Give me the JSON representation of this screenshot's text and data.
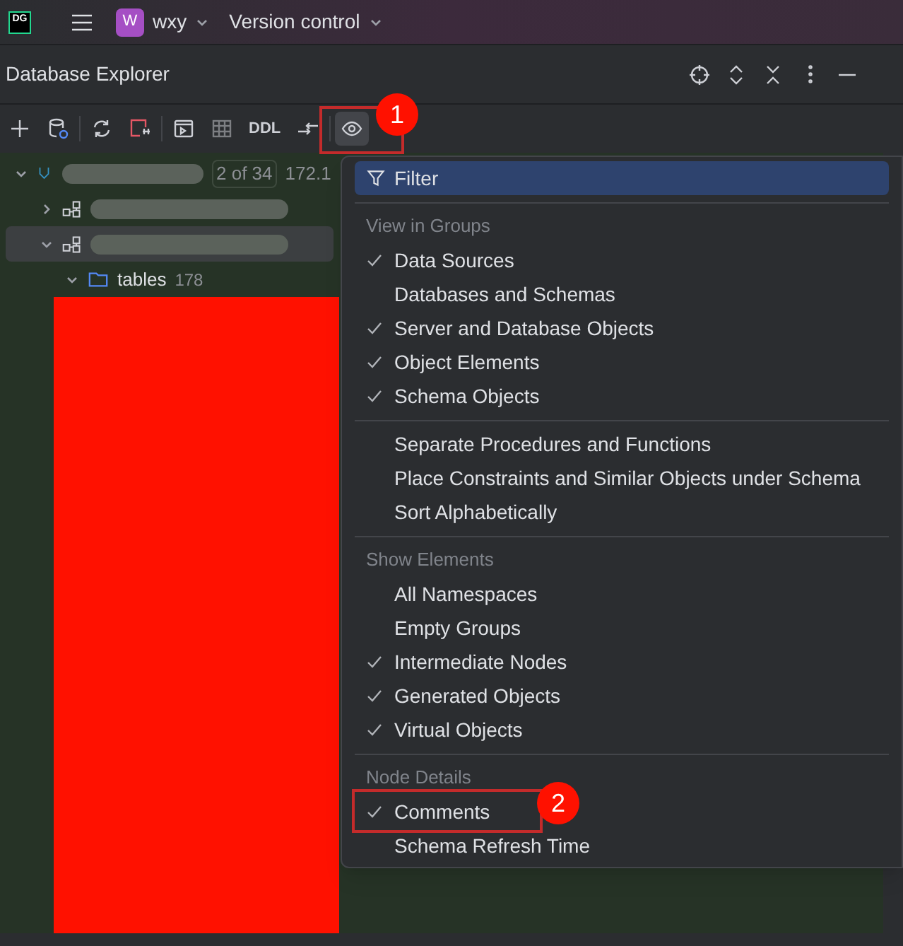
{
  "titlebar": {
    "app_badge": "DG",
    "project_avatar": "W",
    "project": "wxy",
    "vcs": "Version control"
  },
  "panel": {
    "title": "Database Explorer"
  },
  "toolbar": {
    "ddl": "DDL"
  },
  "tree": [
    {
      "expanded": true,
      "selected": false,
      "kind": "datasource",
      "count": "2 of 34",
      "host": "172.1"
    },
    {
      "expanded": false,
      "selected": false,
      "kind": "schema"
    },
    {
      "expanded": true,
      "selected": true,
      "kind": "schema"
    },
    {
      "expanded": true,
      "selected": false,
      "kind": "folder",
      "label": "tables",
      "count": "178"
    }
  ],
  "menu": {
    "top": {
      "label": "Filter",
      "selected": true
    },
    "sections": [
      {
        "header": "View in Groups",
        "items": [
          {
            "label": "Data Sources",
            "checked": true
          },
          {
            "label": "Databases and Schemas",
            "checked": false
          },
          {
            "label": "Server and Database Objects",
            "checked": true
          },
          {
            "label": "Object Elements",
            "checked": true
          },
          {
            "label": "Schema Objects",
            "checked": true
          }
        ]
      },
      {
        "items": [
          {
            "label": "Separate Procedures and Functions",
            "checked": false
          },
          {
            "label": "Place Constraints and Similar Objects under Schema",
            "checked": false
          },
          {
            "label": "Sort Alphabetically",
            "checked": false
          }
        ]
      },
      {
        "header": "Show Elements",
        "items": [
          {
            "label": "All Namespaces",
            "checked": false
          },
          {
            "label": "Empty Groups",
            "checked": false
          },
          {
            "label": "Intermediate Nodes",
            "checked": true
          },
          {
            "label": "Generated Objects",
            "checked": true
          },
          {
            "label": "Virtual Objects",
            "checked": true
          }
        ]
      },
      {
        "header": "Node Details",
        "items": [
          {
            "label": "Comments",
            "checked": true
          },
          {
            "label": "Schema Refresh Time",
            "checked": false
          }
        ]
      }
    ]
  },
  "annotations": [
    "1",
    "2"
  ]
}
